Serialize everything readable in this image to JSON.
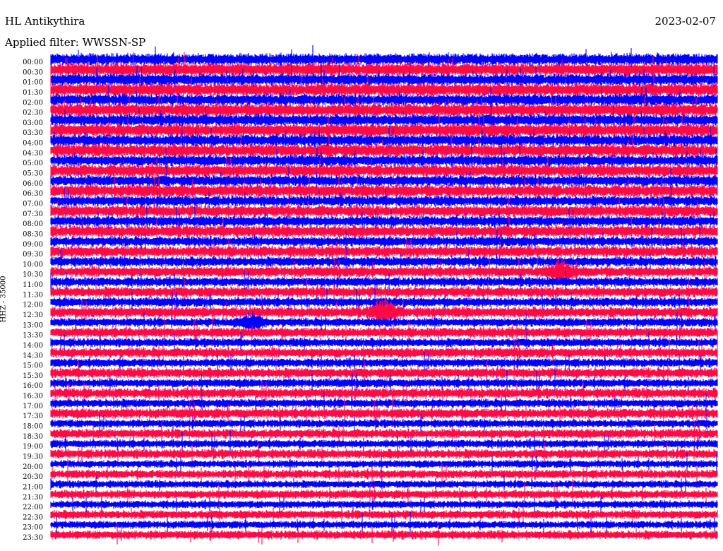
{
  "chart_data": {
    "type": "line",
    "subtype": "helicorder",
    "title": "HL Antikythira",
    "date": "2023-02-07",
    "filter_label": "Applied filter: WWSSN-SP",
    "ylabel": "HHZ - 35000",
    "row_minutes": 30,
    "row_ticks": [
      "00:00",
      "00:30",
      "01:00",
      "01:30",
      "02:00",
      "02:30",
      "03:00",
      "03:30",
      "04:00",
      "04:30",
      "05:00",
      "05:30",
      "06:00",
      "06:30",
      "07:00",
      "07:30",
      "08:00",
      "08:30",
      "09:00",
      "09:30",
      "10:00",
      "10:30",
      "11:00",
      "11:30",
      "12:00",
      "12:30",
      "13:00",
      "13:30",
      "14:00",
      "14:30",
      "15:00",
      "15:30",
      "16:00",
      "16:30",
      "17:00",
      "17:30",
      "18:00",
      "18:30",
      "19:00",
      "19:30",
      "20:00",
      "20:30",
      "21:00",
      "21:30",
      "22:00",
      "22:30",
      "23:00",
      "23:30"
    ],
    "colors": [
      "#0000ff",
      "#ff0a45"
    ],
    "relative_noise_level": [
      1.0,
      1.0,
      1.0,
      1.0,
      1.0,
      1.0,
      1.0,
      1.0,
      1.0,
      1.0,
      0.95,
      0.95,
      0.95,
      0.95,
      0.9,
      0.9,
      0.9,
      0.9,
      0.85,
      0.85,
      0.85,
      0.8,
      0.8,
      0.8,
      0.8,
      0.8,
      0.75,
      0.75,
      0.75,
      0.75,
      0.75,
      0.75,
      0.75,
      0.75,
      0.75,
      0.75,
      0.7,
      0.7,
      0.7,
      0.7,
      0.65,
      0.65,
      0.65,
      0.65,
      0.65,
      0.65,
      0.65,
      0.65
    ],
    "events": [
      {
        "time": "10:30",
        "minute_offset": 23,
        "strength": 1.6
      },
      {
        "time": "12:30",
        "minute_offset": 15,
        "strength": 2.0
      },
      {
        "time": "13:00",
        "minute_offset": 9,
        "strength": 1.5
      }
    ]
  }
}
